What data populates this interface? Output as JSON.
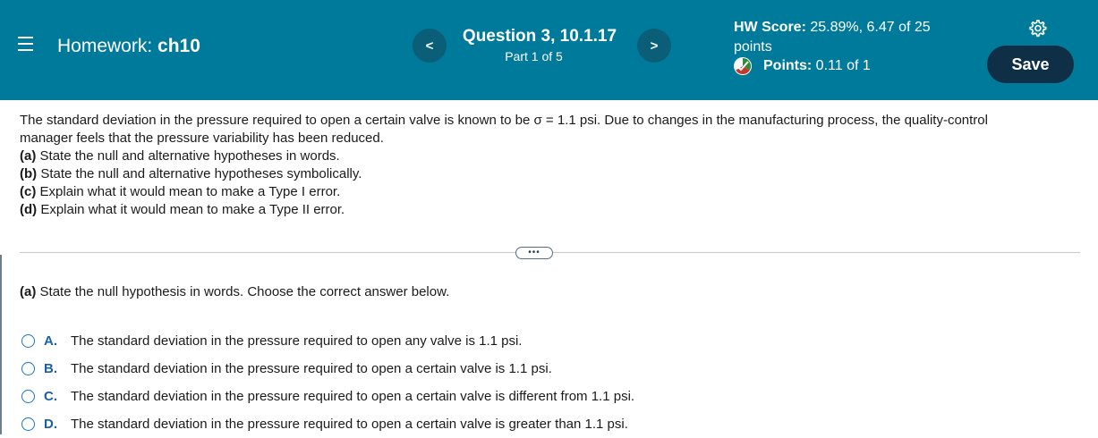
{
  "header": {
    "homework_prefix": "Homework:",
    "homework_name": "ch10",
    "question_title": "Question 3, 10.1.17",
    "question_part": "Part 1 of 5",
    "prev_label": "<",
    "next_label": ">",
    "hw_score_label": "HW Score:",
    "hw_score_value": "25.89%, 6.47 of 25",
    "hw_score_unit": "points",
    "points_label": "Points:",
    "points_value": "0.11 of 1",
    "save_label": "Save"
  },
  "problem": {
    "intro_line1": "The standard deviation in the pressure required to open a certain valve is known to be σ = 1.1 psi. Due to changes in the manufacturing process, the quality-control",
    "intro_line2": "manager feels that the pressure variability has been reduced.",
    "parts": [
      {
        "tag": "(a)",
        "text": "State the null and alternative hypotheses in words."
      },
      {
        "tag": "(b)",
        "text": "State the null and alternative hypotheses symbolically."
      },
      {
        "tag": "(c)",
        "text": "Explain what it would mean to make a Type I error."
      },
      {
        "tag": "(d)",
        "text": "Explain what it would mean to make a Type II error."
      }
    ]
  },
  "more_label": "•••",
  "question_part": {
    "tag": "(a)",
    "text": "State the null hypothesis in words. Choose the correct answer below."
  },
  "options": [
    {
      "letter": "A.",
      "text": "The standard deviation in the pressure required to open any valve is 1.1 psi."
    },
    {
      "letter": "B.",
      "text": "The standard deviation in the pressure required to open a certain valve is 1.1 psi."
    },
    {
      "letter": "C.",
      "text": "The standard deviation in the pressure required to open a certain valve is different from 1.1 psi."
    },
    {
      "letter": "D.",
      "text": "The standard deviation in the pressure required to open a certain valve is greater than 1.1 psi."
    }
  ],
  "colors": {
    "header_bg": "#007a9a",
    "save_bg": "#0e2f45",
    "option_accent": "#1a73c9"
  },
  "icons": [
    "menu-icon",
    "chevron-left-icon",
    "chevron-right-icon",
    "points-status-icon",
    "gear-icon"
  ]
}
